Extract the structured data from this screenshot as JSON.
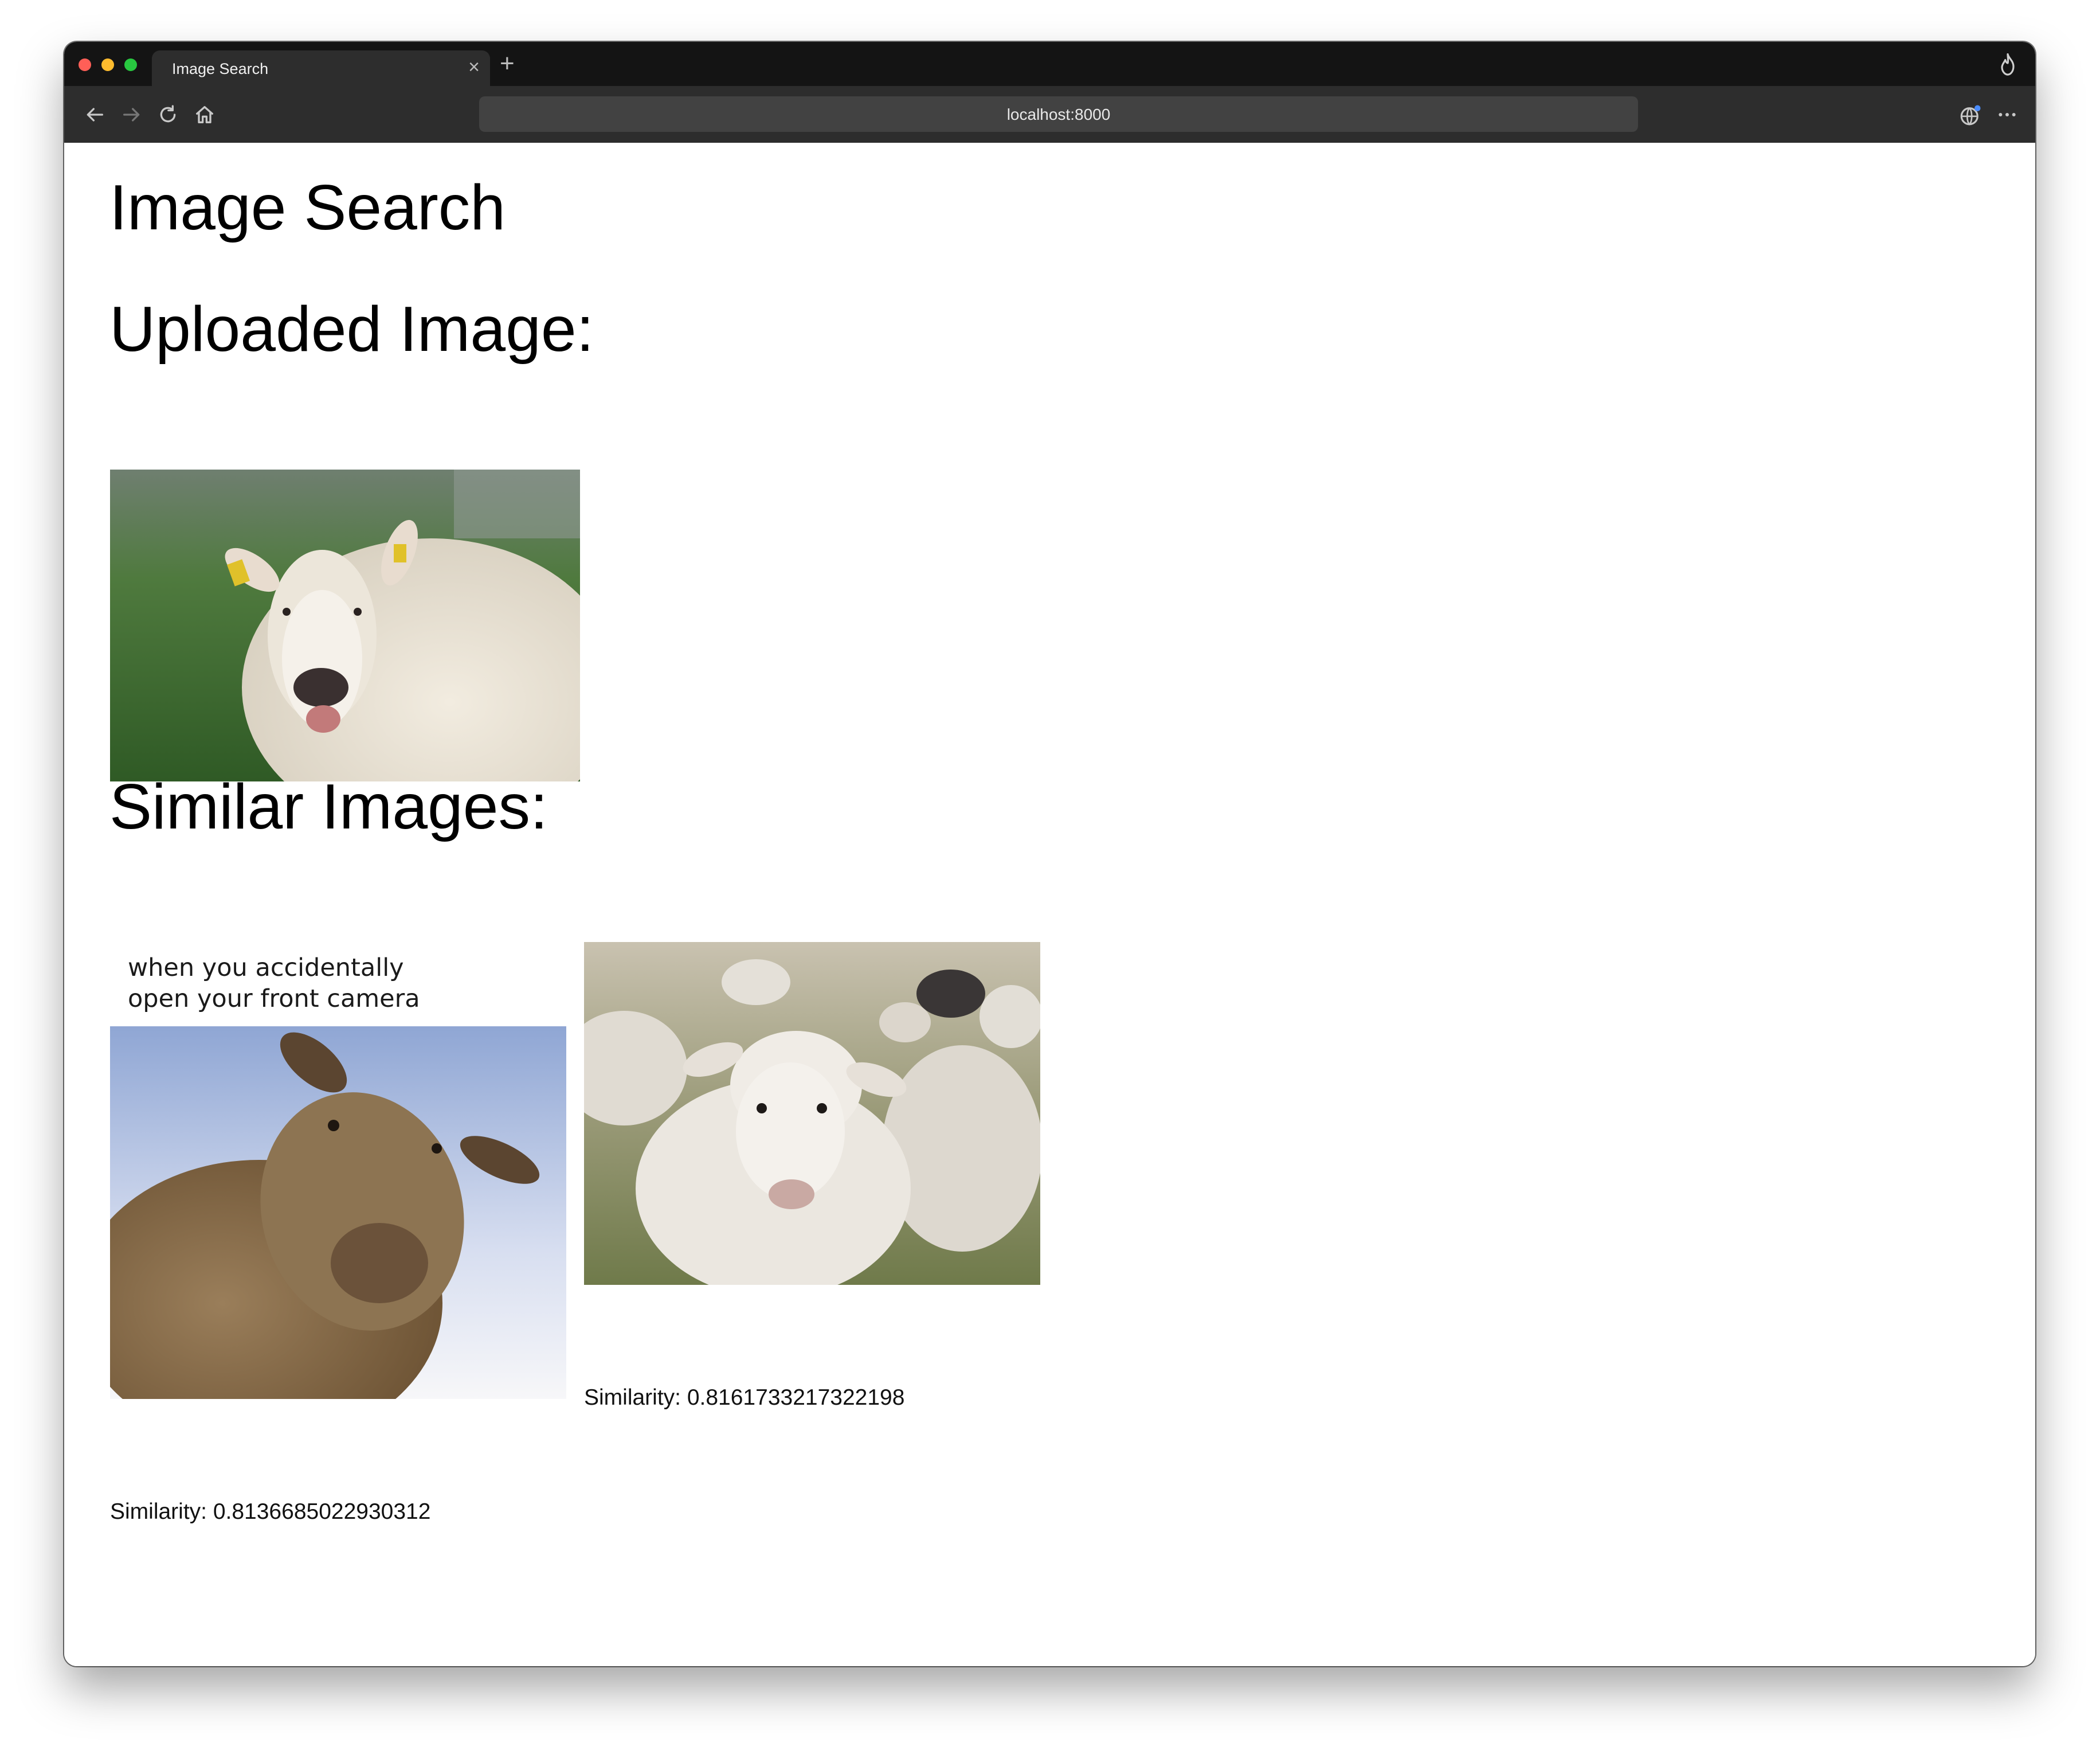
{
  "browser": {
    "tab_title": "Image Search",
    "tab_close": "×",
    "new_tab": "+",
    "url": "localhost:8000",
    "icons": [
      "back-arrow-icon",
      "forward-arrow-icon",
      "reload-icon",
      "home-icon",
      "flame-icon",
      "extension-icon",
      "more-menu-icon"
    ]
  },
  "page": {
    "title": "Image Search",
    "uploaded_heading": "Uploaded Image:",
    "similar_heading": "Similar Images:",
    "uploaded_image": "sheep close-up with yellow ear tags in green field",
    "results": [
      {
        "image": "brown sheep meme photo",
        "meme_caption": "when you accidentally\nopen your front camera",
        "similarity": "Similarity: 0.8136685022930312"
      },
      {
        "image": "white curly sheep in flock on meadow",
        "similarity": "Similarity: 0.8161733217322198"
      }
    ]
  },
  "colors": {
    "tabstrip": "#141414",
    "toolbar": "#2d2d2d",
    "urlbar": "#424242",
    "page_bg": "#ffffff",
    "text": "#000000"
  }
}
